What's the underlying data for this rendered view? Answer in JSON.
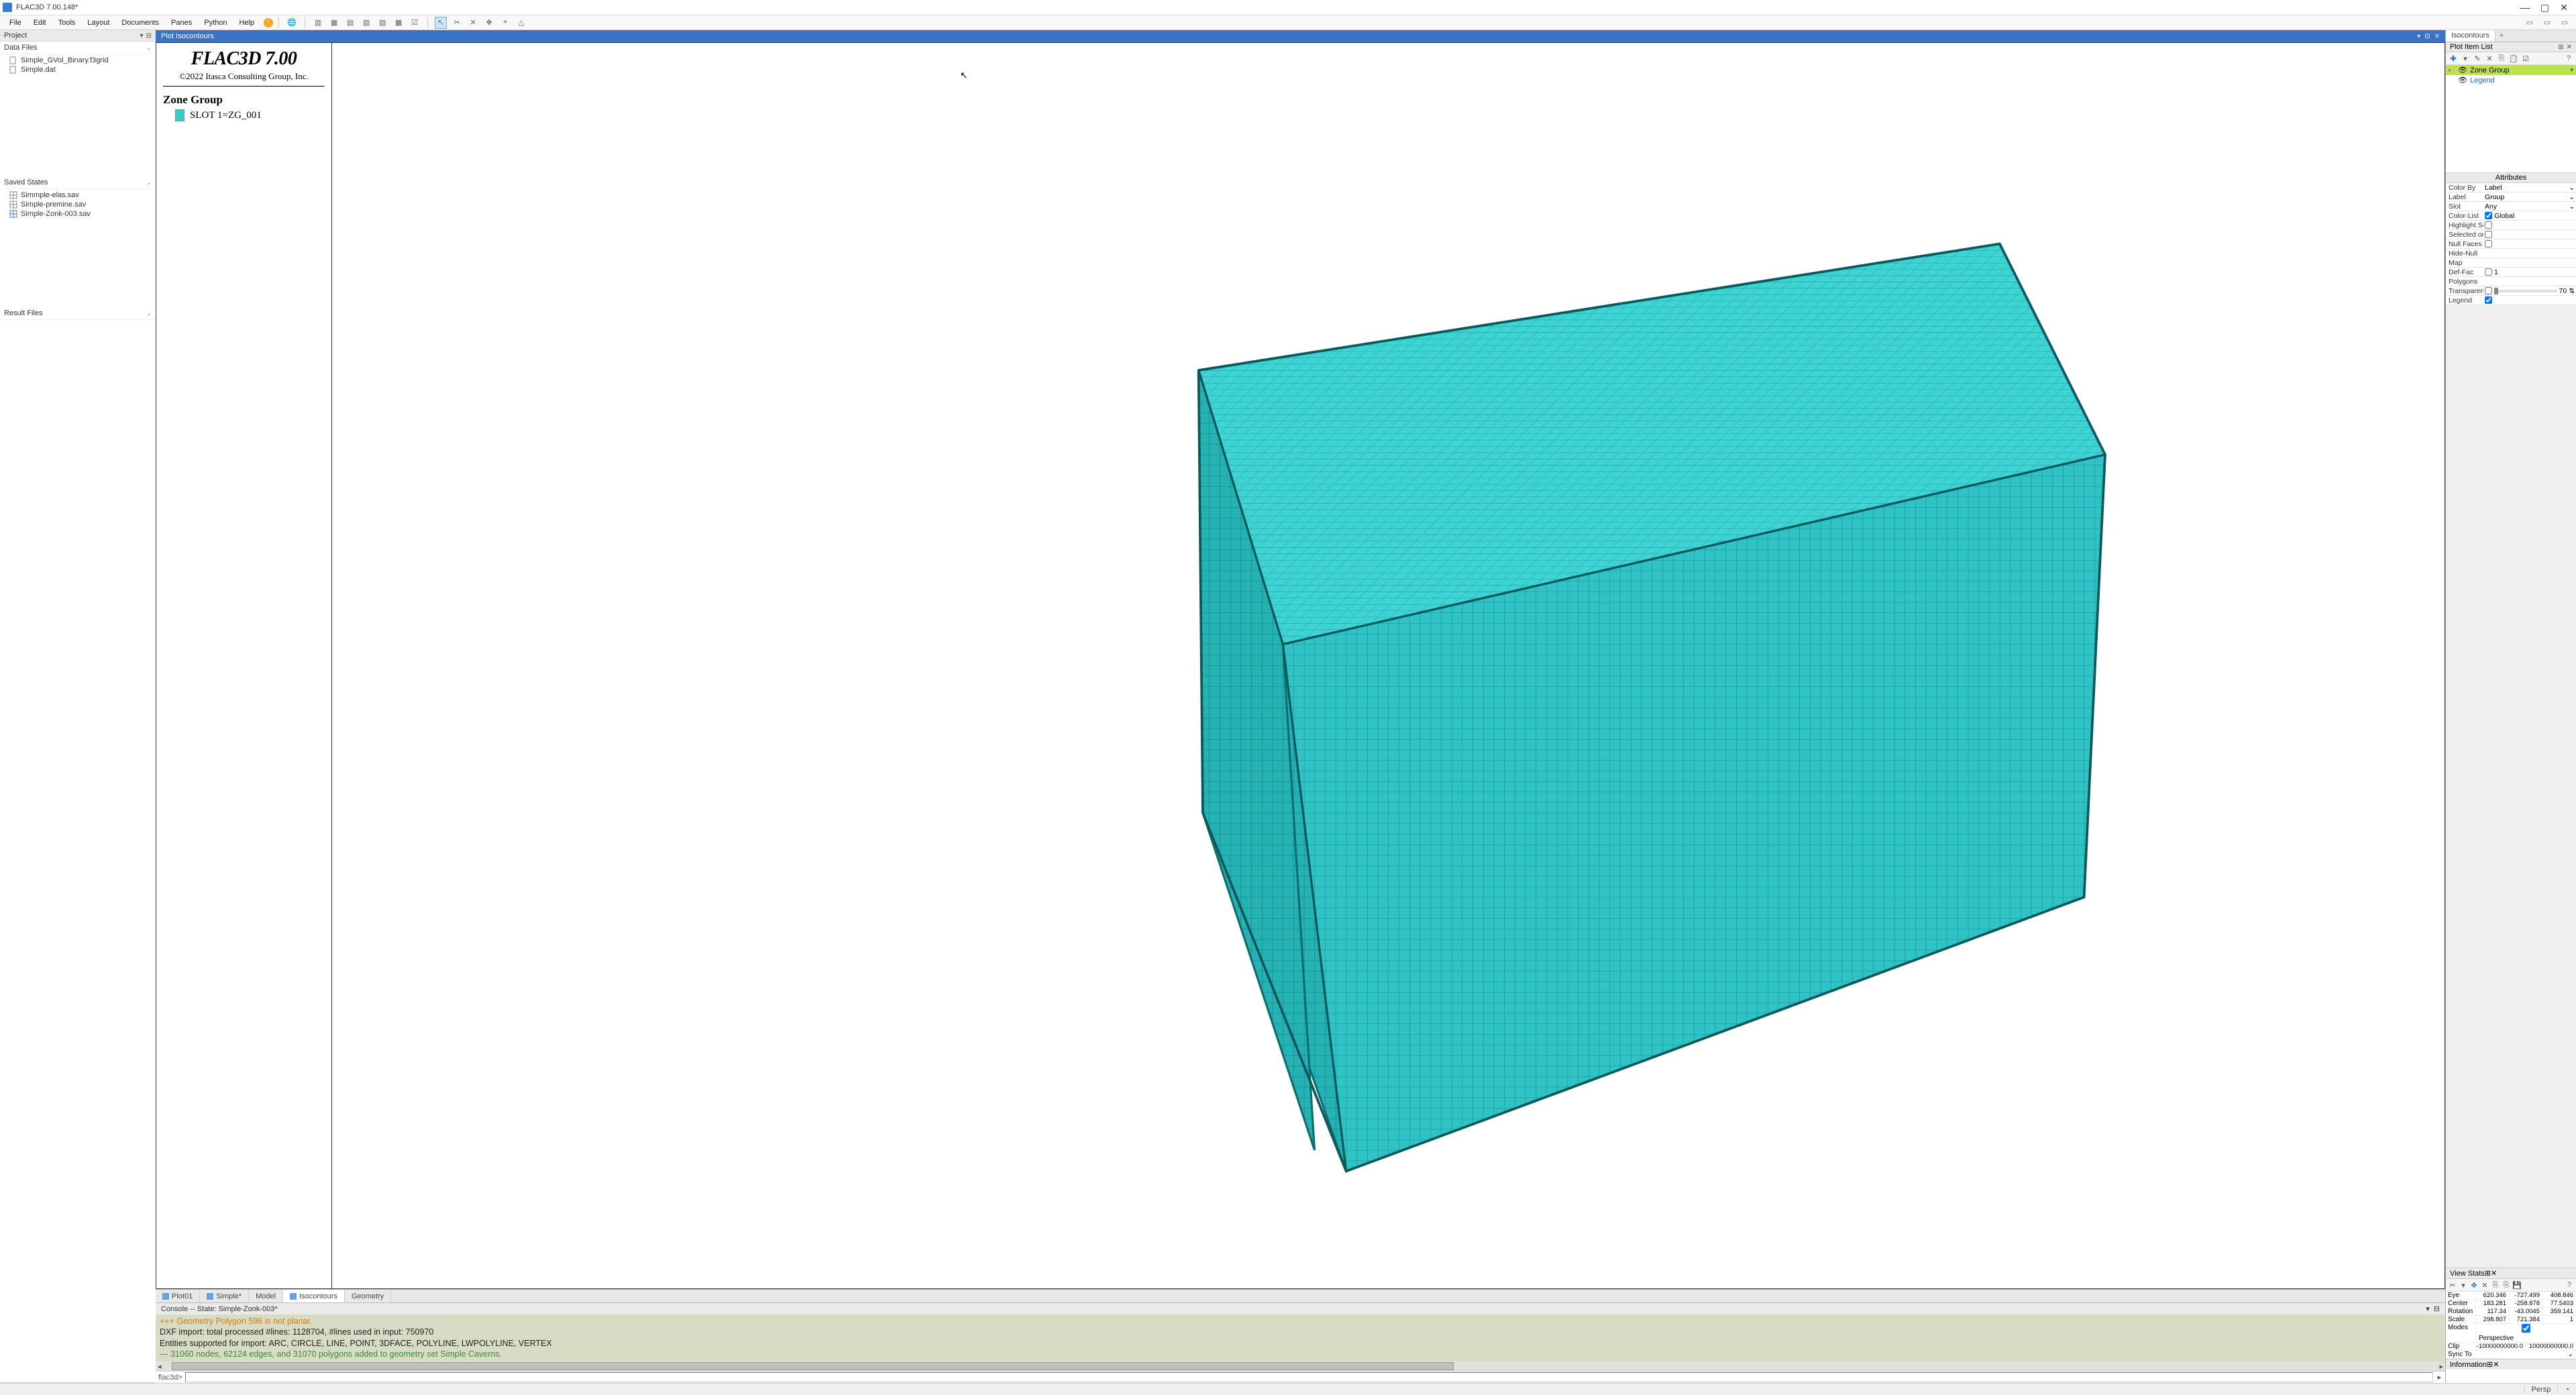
{
  "app": {
    "title": "FLAC3D 7.00.148*"
  },
  "menus": [
    "File",
    "Edit",
    "Tools",
    "Layout",
    "Documents",
    "Panes",
    "Python",
    "Help"
  ],
  "left": {
    "project_label": "Project",
    "data_files_label": "Data Files",
    "data_files": [
      "Simple_GVol_Binary.f3grid",
      "Simple.dat"
    ],
    "saved_states_label": "Saved States",
    "saved_states": [
      "Simmple-elas.sav",
      "Simple-premine.sav",
      "Simple-Zonk-003.sav"
    ],
    "result_files_label": "Result Files"
  },
  "plot": {
    "title": "Plot Isocontours",
    "legend_title": "FLAC3D 7.00",
    "copyright": "©2022 Itasca Consulting Group, Inc.",
    "zone_group_title": "Zone Group",
    "zone_group_item": "SLOT 1=ZG_001"
  },
  "bottom_tabs": [
    {
      "label": "Plot01",
      "icon": true
    },
    {
      "label": "Simple*",
      "icon": true
    },
    {
      "label": "Model",
      "icon": false
    },
    {
      "label": "Isocontours",
      "icon": true,
      "active": true
    },
    {
      "label": "Geometry",
      "icon": false
    }
  ],
  "console": {
    "header": "Console -- State: Simple-Zonk-003*",
    "lines": [
      {
        "cls": "orange",
        "text": "+++ Geometry Polygon 596 is not planar."
      },
      {
        "cls": "black",
        "text": " DXF import: total processed #lines: 1128704, #lines used in input: 750970"
      },
      {
        "cls": "black",
        "text": "Entities supported for import: ARC, CIRCLE, LINE, POINT, 3DFACE, POLYLINE, LWPOLYLINE, VERTEX"
      },
      {
        "cls": "green",
        "text": "--- 31060 nodes, 62124 edges, and 31070 polygons added to geometry set Simple Caverns."
      }
    ],
    "prompt": "flac3d>"
  },
  "right": {
    "tab_isocontours": "Isocontours",
    "plot_item_list": "Plot Item List",
    "items": [
      {
        "label": "Zone Group",
        "selected": true
      },
      {
        "label": "Legend",
        "selected": false
      }
    ],
    "attributes_label": "Attributes",
    "attrs": {
      "color_by_l": "Color By",
      "color_by_v": "Label",
      "label_l": "Label",
      "label_v": "Group",
      "slot_l": "Slot",
      "slot_v": "Any",
      "color_list_l": "Color-List",
      "color_list_chk": true,
      "color_list_txt": "Global",
      "highlight_l": "Highlight Sele",
      "highlight_chk": false,
      "selonly_l": "Selected only",
      "selonly_chk": false,
      "nullfaces_l": "Null Faces",
      "nullfaces_chk": false,
      "hidenull_l": "Hide-Null",
      "map_l": "Map",
      "deffac_l": "Def-Fac",
      "deffac_chk": false,
      "deffac_v": "1",
      "polygons_l": "Polygons",
      "transp_l": "Transparency",
      "transp_chk": false,
      "transp_v": "70",
      "legend_l": "Legend",
      "legend_chk": true
    },
    "view_stats_label": "View Stats",
    "vs": {
      "eye_l": "Eye",
      "eye": [
        "620.346",
        "-727.499",
        "408.846"
      ],
      "center_l": "Center",
      "center": [
        "183.281",
        "-258.878",
        "77.5403"
      ],
      "rot_l": "Rotation",
      "rot": [
        "117.34",
        "-43.0045",
        "359.141"
      ],
      "scale_l": "Scale",
      "scale": [
        "298.807",
        "721.384",
        "1"
      ],
      "modes_l": "Modes",
      "perspective": "Perspective",
      "clip_l": "Clip",
      "clip": [
        "-10000000000.0",
        "10000000000.0"
      ],
      "sync_l": "Sync To"
    },
    "information_label": "Information"
  },
  "status": {
    "persp": "Persp"
  }
}
